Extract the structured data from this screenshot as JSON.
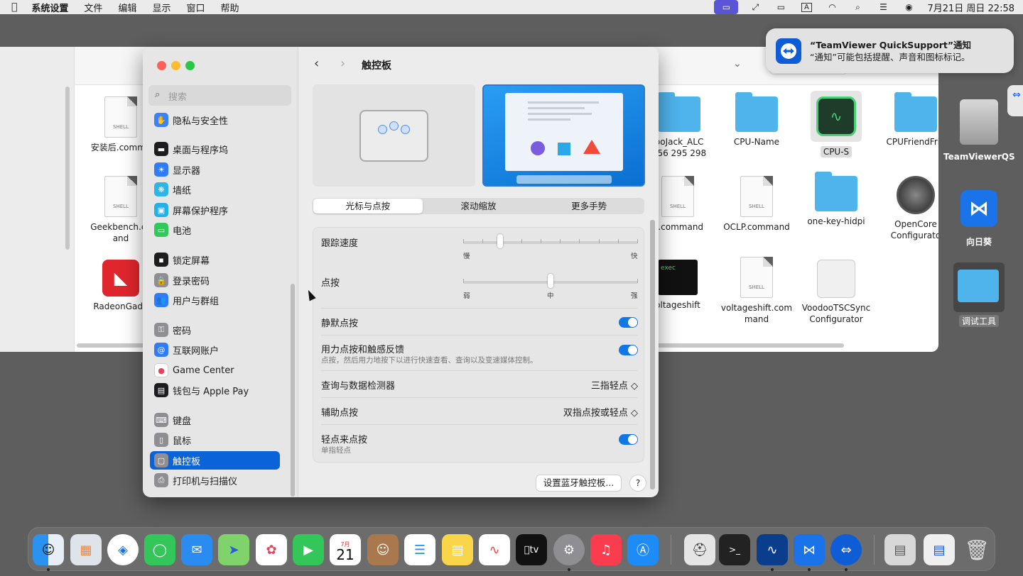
{
  "menubar": {
    "items": [
      "系统设置",
      "文件",
      "编辑",
      "显示",
      "窗口",
      "帮助"
    ],
    "status_input": "A",
    "clock": "7月21日 周日  22:58"
  },
  "finder": {
    "search_placeholder": "搜索",
    "files": [
      {
        "name": "安装后.comma",
        "kind": "shell",
        "tag": "SHELL"
      },
      {
        "name": "Geekbench.co\nand",
        "kind": "shell",
        "tag": "SHELL"
      },
      {
        "name": "RadeonGadg",
        "kind": "amd"
      },
      {
        "name": "boJack_ALC\n256 295 298",
        "kind": "folder"
      },
      {
        "name": "CPU-Name",
        "kind": "folder"
      },
      {
        "name": "CPU-S",
        "kind": "cpus"
      },
      {
        "name": "CPUFriendFrie",
        "kind": "folder"
      },
      {
        "name": "C.command",
        "kind": "shell",
        "tag": "SHELL"
      },
      {
        "name": "OCLP.command",
        "kind": "shell",
        "tag": "SHELL"
      },
      {
        "name": "one-key-hidpi",
        "kind": "folder"
      },
      {
        "name": "OpenCore\nConfigurato",
        "kind": "opencore"
      },
      {
        "name": "oltageshift",
        "kind": "exec",
        "tag": "exec"
      },
      {
        "name": "voltageshift.com\nmand",
        "kind": "shell",
        "tag": "SHELL"
      },
      {
        "name": "VoodooTSCSync\nConfigurator",
        "kind": "lego"
      }
    ]
  },
  "desktop": {
    "icons": [
      {
        "name": "TeamViewerQS"
      },
      {
        "name": "向日葵"
      },
      {
        "name": "调试工具"
      }
    ]
  },
  "notification": {
    "title": "“TeamViewer QuickSupport”通知",
    "body": "“通知”可能包括提醒、声音和图标标记。"
  },
  "settings": {
    "search_placeholder": "搜索",
    "sidebar": [
      {
        "label": "隐私与安全性",
        "color": "#3b82f6",
        "glyph": "✋"
      },
      {
        "label": "桌面与程序坞",
        "color": "#1d1d1f",
        "glyph": "▬"
      },
      {
        "label": "显示器",
        "color": "#2f7cf6",
        "glyph": "☀"
      },
      {
        "label": "墙纸",
        "color": "#2fb4e8",
        "glyph": "❋"
      },
      {
        "label": "屏幕保护程序",
        "color": "#27b0e6",
        "glyph": "▣"
      },
      {
        "label": "电池",
        "color": "#34c759",
        "glyph": "▭"
      },
      {
        "label": "锁定屏幕",
        "color": "#1d1d1f",
        "glyph": "▪"
      },
      {
        "label": "登录密码",
        "color": "#8e8e93",
        "glyph": "🔒"
      },
      {
        "label": "用户与群组",
        "color": "#2f7cf6",
        "glyph": "👥"
      },
      {
        "label": "密码",
        "color": "#8e8e93",
        "glyph": "⚿"
      },
      {
        "label": "互联网账户",
        "color": "#2f7cf6",
        "glyph": "@"
      },
      {
        "label": "Game Center",
        "color": "#ffffff",
        "glyph": "●"
      },
      {
        "label": "钱包与 Apple Pay",
        "color": "#1d1d1f",
        "glyph": "▤"
      },
      {
        "label": "键盘",
        "color": "#8e8e93",
        "glyph": "⌨"
      },
      {
        "label": "鼠标",
        "color": "#8e8e93",
        "glyph": "▯"
      },
      {
        "label": "触控板",
        "color": "#8e8e93",
        "glyph": "▢",
        "active": true
      },
      {
        "label": "打印机与扫描仪",
        "color": "#8e8e93",
        "glyph": "⎙"
      }
    ],
    "main": {
      "title": "触控板",
      "tabs": [
        "光标与点按",
        "滚动缩放",
        "更多手势"
      ],
      "active_tab": "光标与点按",
      "tracking": {
        "label": "跟踪速度",
        "min": "慢",
        "max": "快",
        "level": 0.2
      },
      "click": {
        "label": "点按",
        "min": "弱",
        "mid": "中",
        "max": "强",
        "level": 0.5
      },
      "silent_click": {
        "label": "静默点按",
        "on": true
      },
      "force_click": {
        "label": "用力点按和触感反馈",
        "desc": "点按，然后用力地按下以进行快速查看、查询以及变速媒体控制。",
        "on": true
      },
      "lookup": {
        "label": "查询与数据检测器",
        "value": "三指轻点 ◇"
      },
      "secondary": {
        "label": "辅助点按",
        "value": "双指点按或轻点 ◇"
      },
      "tap_click": {
        "label": "轻点来点按",
        "desc": "单指轻点",
        "on": true
      },
      "bt_button": "设置蓝牙触控板...",
      "help": "?"
    }
  },
  "dock": {
    "calendar_month": "7月",
    "calendar_day": "21",
    "tv": "tv"
  }
}
